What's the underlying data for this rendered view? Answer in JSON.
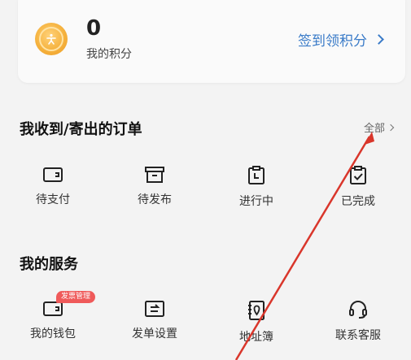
{
  "points": {
    "value": "0",
    "label": "我的积分",
    "signin_label": "签到领积分"
  },
  "orders": {
    "title": "我收到/寄出的订单",
    "view_all": "全部",
    "items": [
      {
        "label": "待支付",
        "icon": "wallet-icon"
      },
      {
        "label": "待发布",
        "icon": "archive-box-icon"
      },
      {
        "label": "进行中",
        "icon": "clipboard-clock-icon"
      },
      {
        "label": "已完成",
        "icon": "clipboard-check-icon"
      }
    ]
  },
  "services": {
    "title": "我的服务",
    "badge": "发票管理",
    "items": [
      {
        "label": "我的钱包",
        "icon": "wallet-icon"
      },
      {
        "label": "发单设置",
        "icon": "send-settings-icon"
      },
      {
        "label": "地址簿",
        "icon": "address-book-icon"
      },
      {
        "label": "联系客服",
        "icon": "headset-icon"
      }
    ]
  },
  "colors": {
    "accent": "#3a7bc8",
    "badge": "#ef5a5a",
    "annotation_arrow": "#d9362b",
    "background": "#f3f3f3"
  }
}
